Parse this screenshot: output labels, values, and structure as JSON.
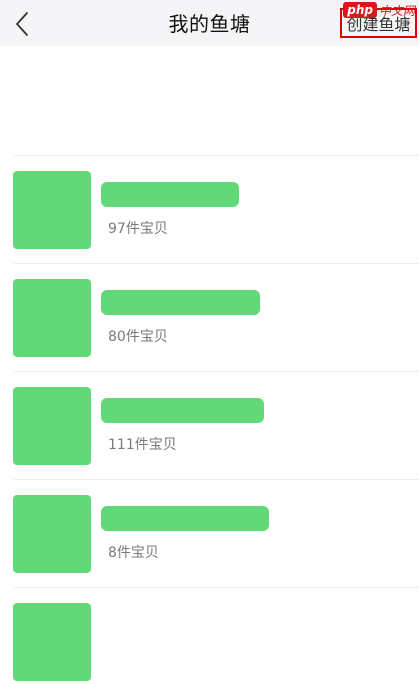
{
  "header": {
    "title": "我的鱼塘",
    "create_label": "创建鱼塘",
    "back_icon": "chevron-left-icon"
  },
  "watermark": {
    "brand": "php",
    "site": "中文网"
  },
  "ponds": [
    {
      "count_text": "97件宝贝",
      "name_bar_fraction": 0.33
    },
    {
      "count_text": "80件宝贝",
      "name_bar_fraction": 0.38
    },
    {
      "count_text": "111件宝贝",
      "name_bar_fraction": 0.39
    },
    {
      "count_text": "8件宝贝",
      "name_bar_fraction": 0.4
    }
  ],
  "colors": {
    "placeholder_green": "#62d978",
    "highlight_red": "#e00000",
    "watermark_red": "#d6191e",
    "navbar_bg": "#f5f5f7"
  }
}
